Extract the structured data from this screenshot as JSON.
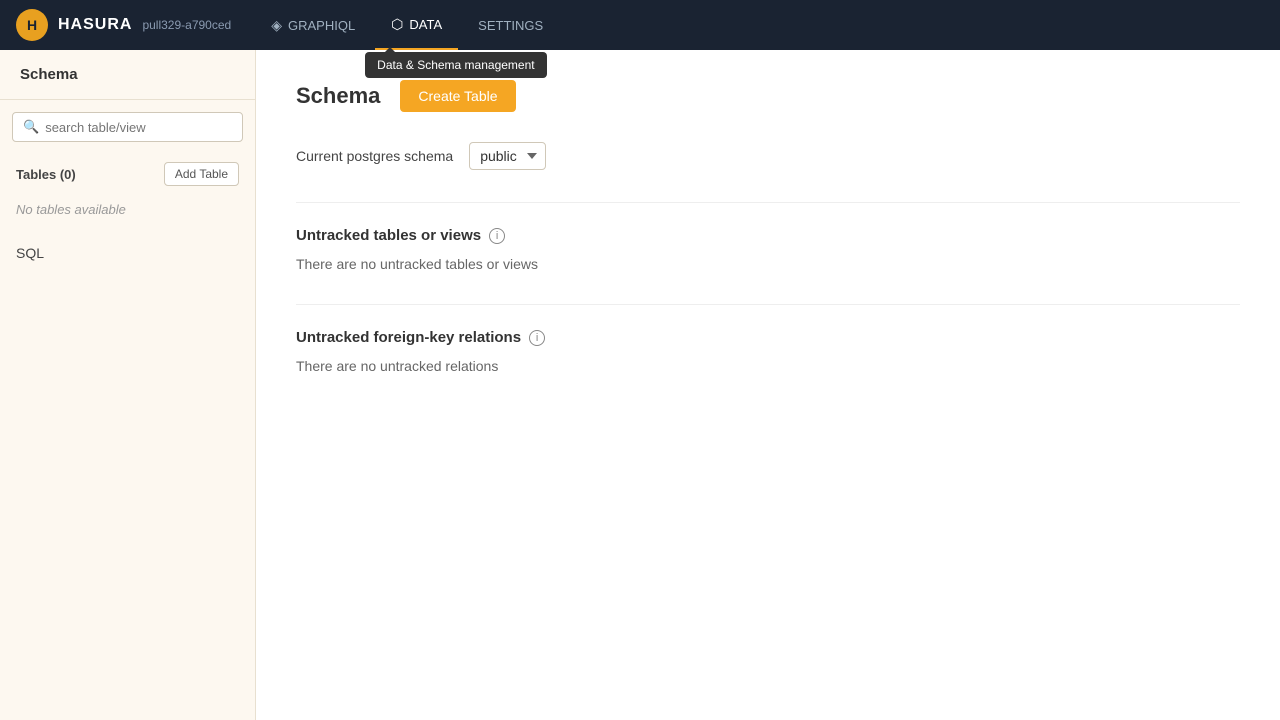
{
  "brand": {
    "logo_text": "H",
    "name": "HASURA",
    "version": "pull329-a790ced"
  },
  "topnav": {
    "items": [
      {
        "id": "graphiql",
        "label": "GRAPHIQL",
        "icon": "◈",
        "active": false
      },
      {
        "id": "data",
        "label": "DATA",
        "icon": "⬡",
        "active": true
      },
      {
        "id": "settings",
        "label": "SETTINGS",
        "icon": "",
        "active": false
      }
    ],
    "tooltip": {
      "text": "Data & Schema management",
      "target": "data"
    }
  },
  "sidebar": {
    "schema_label": "Schema",
    "search_placeholder": "search table/view",
    "tables_label": "Tables (0)",
    "add_table_btn": "Add Table",
    "no_tables_text": "No tables available",
    "sql_label": "SQL"
  },
  "main": {
    "title": "Schema",
    "create_table_btn": "Create Table",
    "schema_row_label": "Current postgres schema",
    "schema_select_value": "public",
    "schema_options": [
      "public"
    ],
    "untracked_tables": {
      "title": "Untracked tables or views",
      "empty_text": "There are no untracked tables or views"
    },
    "untracked_relations": {
      "title": "Untracked foreign-key relations",
      "empty_text": "There are no untracked relations"
    }
  }
}
